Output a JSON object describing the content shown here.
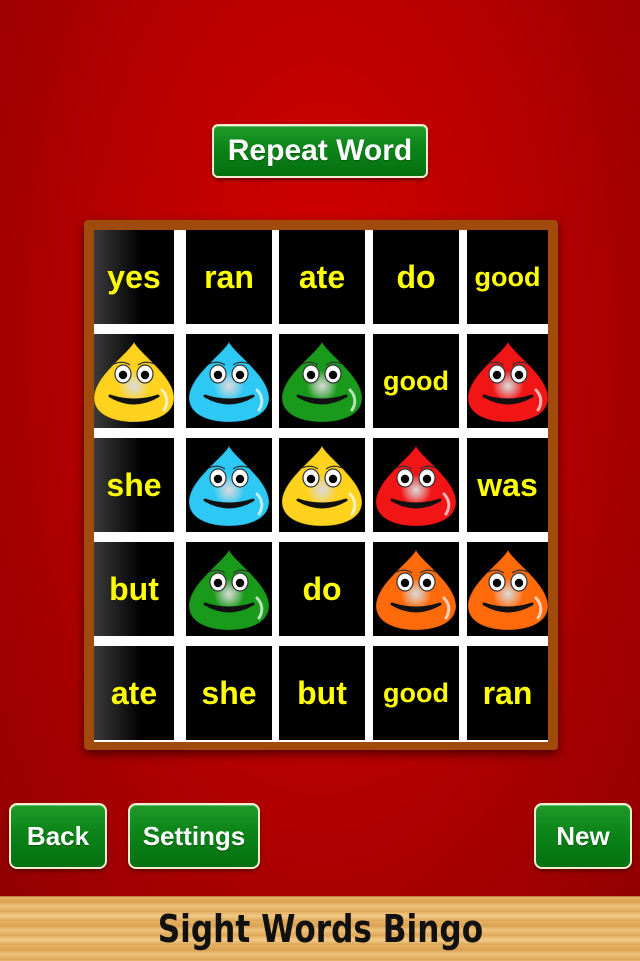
{
  "header": {
    "repeat_label": "Repeat Word"
  },
  "board": {
    "rows": [
      [
        {
          "type": "word",
          "text": "yes"
        },
        {
          "type": "word",
          "text": "ran"
        },
        {
          "type": "word",
          "text": "ate"
        },
        {
          "type": "word",
          "text": "do"
        },
        {
          "type": "word",
          "text": "good"
        }
      ],
      [
        {
          "type": "marker",
          "color": "yellow",
          "icon": "smiley-drop-icon"
        },
        {
          "type": "marker",
          "color": "blue",
          "icon": "smiley-drop-icon"
        },
        {
          "type": "marker",
          "color": "green",
          "icon": "smiley-drop-icon"
        },
        {
          "type": "word",
          "text": "good"
        },
        {
          "type": "marker",
          "color": "red",
          "icon": "smiley-drop-icon"
        }
      ],
      [
        {
          "type": "word",
          "text": "she"
        },
        {
          "type": "marker",
          "color": "blue",
          "icon": "smiley-drop-icon"
        },
        {
          "type": "marker",
          "color": "yellow",
          "icon": "smiley-drop-icon"
        },
        {
          "type": "marker",
          "color": "red",
          "icon": "smiley-drop-icon"
        },
        {
          "type": "word",
          "text": "was"
        }
      ],
      [
        {
          "type": "word",
          "text": "but"
        },
        {
          "type": "marker",
          "color": "green",
          "icon": "smiley-drop-icon"
        },
        {
          "type": "word",
          "text": "do"
        },
        {
          "type": "marker",
          "color": "orange",
          "icon": "smiley-drop-icon"
        },
        {
          "type": "marker",
          "color": "orange",
          "icon": "smiley-drop-icon"
        }
      ],
      [
        {
          "type": "word",
          "text": "ate"
        },
        {
          "type": "word",
          "text": "she"
        },
        {
          "type": "word",
          "text": "but"
        },
        {
          "type": "word",
          "text": "good"
        },
        {
          "type": "word",
          "text": "ran"
        }
      ]
    ],
    "marker_colors": {
      "yellow": "#ffd21e",
      "blue": "#2ec8f5",
      "green": "#1a9a1a",
      "red": "#f21515",
      "orange": "#ff6a0a"
    },
    "word_color": "#ffff00"
  },
  "controls": {
    "back_label": "Back",
    "settings_label": "Settings",
    "new_label": "New"
  },
  "footer": {
    "title": "Sight Words Bingo"
  },
  "colors": {
    "button_green": "#0c8418",
    "background_red": "#b80000",
    "frame_brown": "#a04a0c"
  }
}
